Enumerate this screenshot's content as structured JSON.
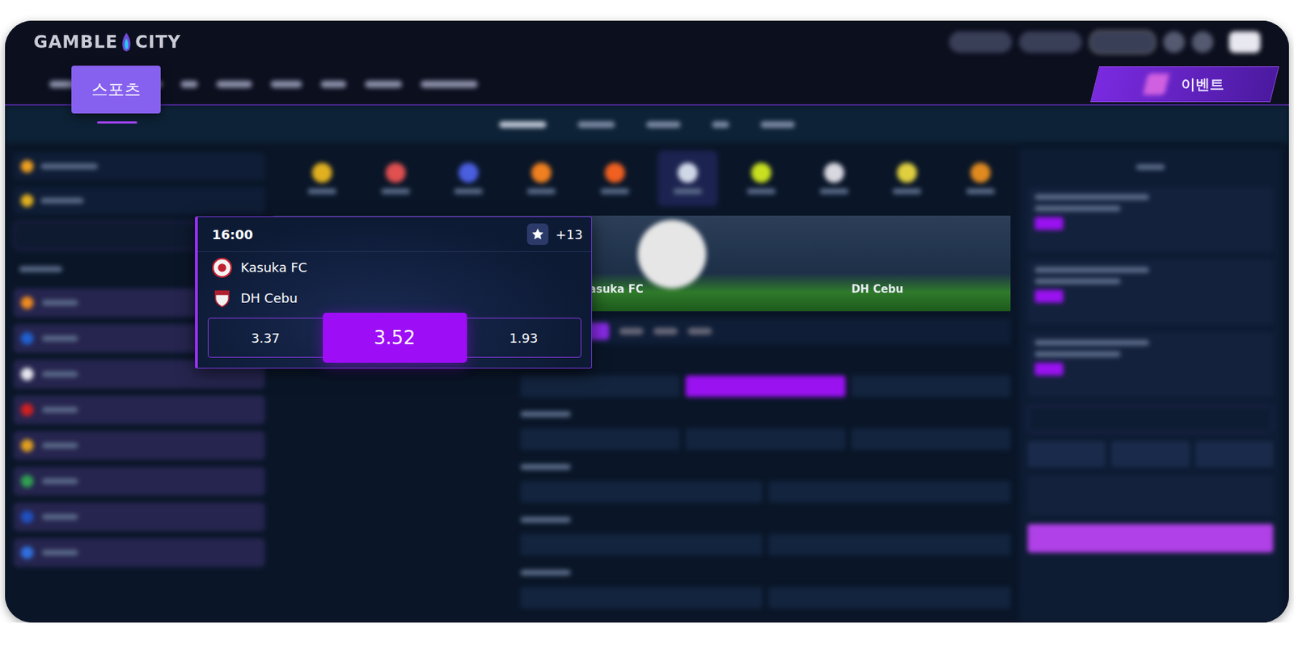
{
  "header": {
    "logo": {
      "left": "GAMBLE",
      "right": "CITY"
    },
    "event_button": "이벤트"
  },
  "nav": {
    "highlighted_tab": {
      "label": "스포츠",
      "selected": true
    }
  },
  "banner": {
    "home": "Kasuka FC",
    "away": "DH Cebu"
  },
  "match_card": {
    "time": "16:00",
    "favorite": true,
    "more": "+13",
    "home": {
      "name": "Kasuka FC"
    },
    "away": {
      "name": "DH Cebu"
    },
    "odds": [
      {
        "value": "3.37",
        "selected": false
      },
      {
        "value": "3.52",
        "selected": true
      },
      {
        "value": "1.93",
        "selected": false
      }
    ]
  }
}
